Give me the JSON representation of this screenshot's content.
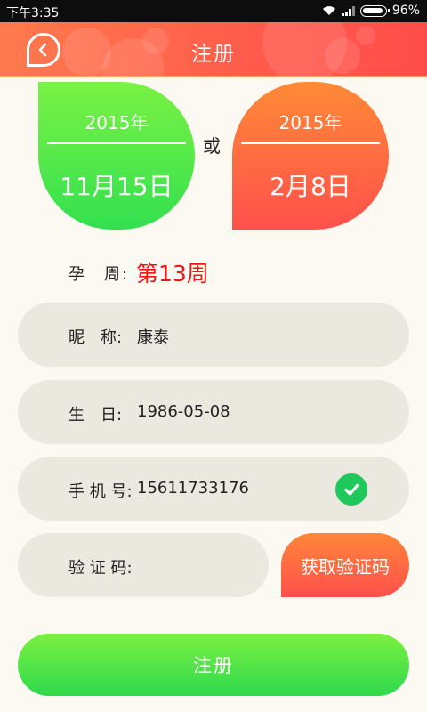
{
  "status_bar": {
    "time": "下午3:35",
    "battery": "96%"
  },
  "header": {
    "title": "注册",
    "back_icon": "back-arrow-icon",
    "color": "#ff5b4c"
  },
  "dates": {
    "green": {
      "year": "2015年",
      "day": "11月15日",
      "color": "#33e04f"
    },
    "orange": {
      "year": "2015年",
      "day": "2月8日",
      "color": "#ff504c"
    },
    "or_text": "或"
  },
  "pregnancy_week": {
    "label": "孕　周:",
    "value": "第13周",
    "color": "#f01414"
  },
  "form": {
    "nickname": {
      "label": "昵　称:",
      "value": "康泰"
    },
    "birthday": {
      "label": "生　日:",
      "value": "1986-05-08"
    },
    "phone": {
      "label": "手 机 号:",
      "value": "15611733176",
      "status_icon": "check-circle-icon"
    },
    "code": {
      "label": "验 证 码:",
      "value": "",
      "button_label": "获取验证码"
    }
  },
  "register_button": {
    "label": "注册",
    "color": "#2fd94e"
  }
}
